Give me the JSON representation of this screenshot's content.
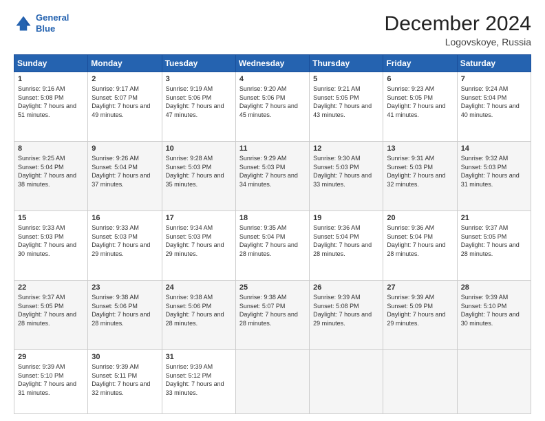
{
  "header": {
    "logo_line1": "General",
    "logo_line2": "Blue",
    "month": "December 2024",
    "location": "Logovskoye, Russia"
  },
  "days_of_week": [
    "Sunday",
    "Monday",
    "Tuesday",
    "Wednesday",
    "Thursday",
    "Friday",
    "Saturday"
  ],
  "weeks": [
    [
      {
        "day": 1,
        "sunrise": "9:16 AM",
        "sunset": "5:08 PM",
        "daylight": "7 hours and 51 minutes."
      },
      {
        "day": 2,
        "sunrise": "9:17 AM",
        "sunset": "5:07 PM",
        "daylight": "7 hours and 49 minutes."
      },
      {
        "day": 3,
        "sunrise": "9:19 AM",
        "sunset": "5:06 PM",
        "daylight": "7 hours and 47 minutes."
      },
      {
        "day": 4,
        "sunrise": "9:20 AM",
        "sunset": "5:06 PM",
        "daylight": "7 hours and 45 minutes."
      },
      {
        "day": 5,
        "sunrise": "9:21 AM",
        "sunset": "5:05 PM",
        "daylight": "7 hours and 43 minutes."
      },
      {
        "day": 6,
        "sunrise": "9:23 AM",
        "sunset": "5:05 PM",
        "daylight": "7 hours and 41 minutes."
      },
      {
        "day": 7,
        "sunrise": "9:24 AM",
        "sunset": "5:04 PM",
        "daylight": "7 hours and 40 minutes."
      }
    ],
    [
      {
        "day": 8,
        "sunrise": "9:25 AM",
        "sunset": "5:04 PM",
        "daylight": "7 hours and 38 minutes."
      },
      {
        "day": 9,
        "sunrise": "9:26 AM",
        "sunset": "5:04 PM",
        "daylight": "7 hours and 37 minutes."
      },
      {
        "day": 10,
        "sunrise": "9:28 AM",
        "sunset": "5:03 PM",
        "daylight": "7 hours and 35 minutes."
      },
      {
        "day": 11,
        "sunrise": "9:29 AM",
        "sunset": "5:03 PM",
        "daylight": "7 hours and 34 minutes."
      },
      {
        "day": 12,
        "sunrise": "9:30 AM",
        "sunset": "5:03 PM",
        "daylight": "7 hours and 33 minutes."
      },
      {
        "day": 13,
        "sunrise": "9:31 AM",
        "sunset": "5:03 PM",
        "daylight": "7 hours and 32 minutes."
      },
      {
        "day": 14,
        "sunrise": "9:32 AM",
        "sunset": "5:03 PM",
        "daylight": "7 hours and 31 minutes."
      }
    ],
    [
      {
        "day": 15,
        "sunrise": "9:33 AM",
        "sunset": "5:03 PM",
        "daylight": "7 hours and 30 minutes."
      },
      {
        "day": 16,
        "sunrise": "9:33 AM",
        "sunset": "5:03 PM",
        "daylight": "7 hours and 29 minutes."
      },
      {
        "day": 17,
        "sunrise": "9:34 AM",
        "sunset": "5:03 PM",
        "daylight": "7 hours and 29 minutes."
      },
      {
        "day": 18,
        "sunrise": "9:35 AM",
        "sunset": "5:04 PM",
        "daylight": "7 hours and 28 minutes."
      },
      {
        "day": 19,
        "sunrise": "9:36 AM",
        "sunset": "5:04 PM",
        "daylight": "7 hours and 28 minutes."
      },
      {
        "day": 20,
        "sunrise": "9:36 AM",
        "sunset": "5:04 PM",
        "daylight": "7 hours and 28 minutes."
      },
      {
        "day": 21,
        "sunrise": "9:37 AM",
        "sunset": "5:05 PM",
        "daylight": "7 hours and 28 minutes."
      }
    ],
    [
      {
        "day": 22,
        "sunrise": "9:37 AM",
        "sunset": "5:05 PM",
        "daylight": "7 hours and 28 minutes."
      },
      {
        "day": 23,
        "sunrise": "9:38 AM",
        "sunset": "5:06 PM",
        "daylight": "7 hours and 28 minutes."
      },
      {
        "day": 24,
        "sunrise": "9:38 AM",
        "sunset": "5:06 PM",
        "daylight": "7 hours and 28 minutes."
      },
      {
        "day": 25,
        "sunrise": "9:38 AM",
        "sunset": "5:07 PM",
        "daylight": "7 hours and 28 minutes."
      },
      {
        "day": 26,
        "sunrise": "9:39 AM",
        "sunset": "5:08 PM",
        "daylight": "7 hours and 29 minutes."
      },
      {
        "day": 27,
        "sunrise": "9:39 AM",
        "sunset": "5:09 PM",
        "daylight": "7 hours and 29 minutes."
      },
      {
        "day": 28,
        "sunrise": "9:39 AM",
        "sunset": "5:10 PM",
        "daylight": "7 hours and 30 minutes."
      }
    ],
    [
      {
        "day": 29,
        "sunrise": "9:39 AM",
        "sunset": "5:10 PM",
        "daylight": "7 hours and 31 minutes."
      },
      {
        "day": 30,
        "sunrise": "9:39 AM",
        "sunset": "5:11 PM",
        "daylight": "7 hours and 32 minutes."
      },
      {
        "day": 31,
        "sunrise": "9:39 AM",
        "sunset": "5:12 PM",
        "daylight": "7 hours and 33 minutes."
      },
      null,
      null,
      null,
      null
    ]
  ]
}
